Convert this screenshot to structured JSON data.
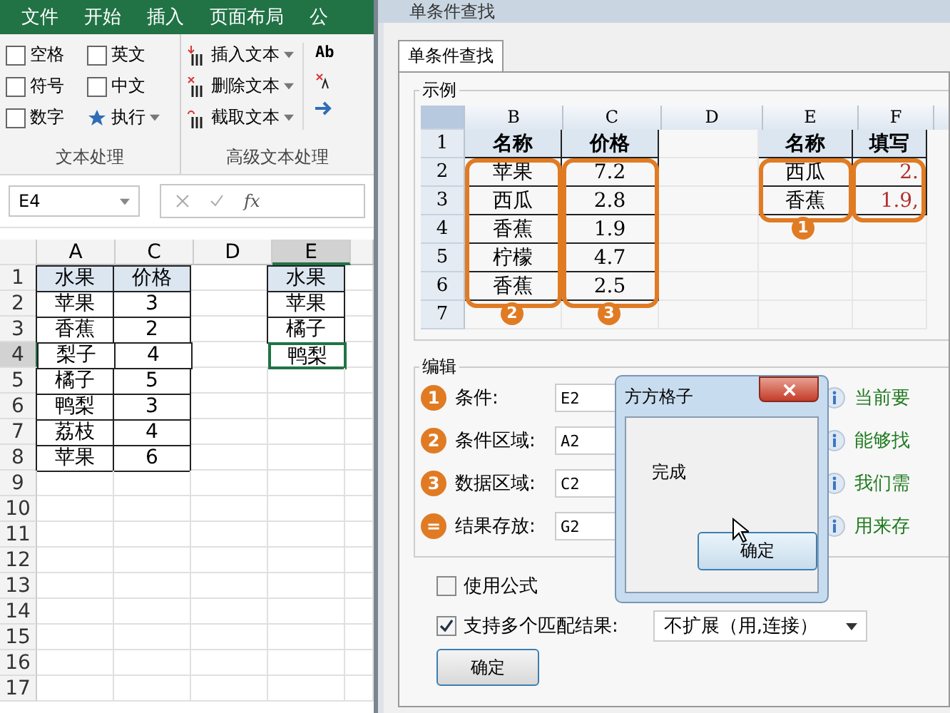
{
  "excel": {
    "menu": [
      "文件",
      "开始",
      "插入",
      "页面布局",
      "公"
    ],
    "checks": [
      {
        "label": "空格",
        "checked": false
      },
      {
        "label": "英文",
        "checked": false
      },
      {
        "label": "符号",
        "checked": false
      },
      {
        "label": "中文",
        "checked": false
      },
      {
        "label": "数字",
        "checked": false
      }
    ],
    "run_button": "执行",
    "group1": "文本处理",
    "tools": [
      {
        "label": "插入文本",
        "kind": "insert"
      },
      {
        "label": "删除文本",
        "kind": "delete"
      },
      {
        "label": "截取文本",
        "kind": "cut"
      }
    ],
    "partial_tool": "Ab",
    "group2": "高级文本处理",
    "name_box": "E4",
    "fx": "fx",
    "columns": [
      {
        "label": "A",
        "selected": false
      },
      {
        "label": "C",
        "selected": false
      },
      {
        "label": "D",
        "selected": false
      },
      {
        "label": "E",
        "selected": true
      }
    ],
    "rows": [
      {
        "num": "1",
        "kind": "header",
        "selected": false,
        "a": "水果",
        "c": "价格",
        "e": "水果"
      },
      {
        "num": "2",
        "kind": "data",
        "selected": false,
        "a": "苹果",
        "c": "3",
        "e": "苹果"
      },
      {
        "num": "3",
        "kind": "data",
        "selected": false,
        "a": "香蕉",
        "c": "2",
        "e": "橘子"
      },
      {
        "num": "4",
        "kind": "data",
        "selected": true,
        "a": "梨子",
        "c": "4",
        "e": "鸭梨"
      },
      {
        "num": "5",
        "kind": "data",
        "selected": false,
        "a": "橘子",
        "c": "5"
      },
      {
        "num": "6",
        "kind": "data",
        "selected": false,
        "a": "鸭梨",
        "c": "3"
      },
      {
        "num": "7",
        "kind": "data",
        "selected": false,
        "a": "荔枝",
        "c": "4"
      },
      {
        "num": "8",
        "kind": "data",
        "selected": false,
        "a": "苹果",
        "c": "6"
      },
      {
        "num": "9",
        "kind": "blank",
        "selected": false
      },
      {
        "num": "10",
        "kind": "blank",
        "selected": false
      },
      {
        "num": "11",
        "kind": "blank",
        "selected": false
      },
      {
        "num": "12",
        "kind": "blank",
        "selected": false
      },
      {
        "num": "13",
        "kind": "blank",
        "selected": false
      },
      {
        "num": "14",
        "kind": "blank",
        "selected": false
      },
      {
        "num": "15",
        "kind": "blank",
        "selected": false
      },
      {
        "num": "16",
        "kind": "blank",
        "selected": false
      },
      {
        "num": "17",
        "kind": "blank",
        "selected": false
      }
    ]
  },
  "dialog": {
    "title": "单条件查找",
    "tab": "单条件查找",
    "sample_title": "示例",
    "sample_columns": [
      "B",
      "C",
      "D",
      "E",
      "F"
    ],
    "sample_rows": [
      {
        "num": "1",
        "kind": "header",
        "b": "名称",
        "c": "价格",
        "e": "名称",
        "f": "填写"
      },
      {
        "num": "2",
        "kind": "data",
        "b": "苹果",
        "c": "7.2",
        "e": "西瓜",
        "f": "2."
      },
      {
        "num": "3",
        "kind": "data",
        "b": "西瓜",
        "c": "2.8",
        "e": "香蕉",
        "f": "1.9,"
      },
      {
        "num": "4",
        "kind": "data",
        "b": "香蕉",
        "c": "1.9"
      },
      {
        "num": "5",
        "kind": "data",
        "b": "柠檬",
        "c": "4.7"
      },
      {
        "num": "6",
        "kind": "data",
        "b": "香蕉",
        "c": "2.5"
      },
      {
        "num": "7",
        "kind": "blank"
      }
    ],
    "markers": [
      "2",
      "3",
      "1"
    ],
    "edit_title": "编辑",
    "fields": [
      {
        "badge": "1",
        "label": "条件:",
        "value": "E2",
        "hint": "当前要"
      },
      {
        "badge": "2",
        "label": "条件区域:",
        "value": "A2",
        "hint": "能够找"
      },
      {
        "badge": "3",
        "label": "数据区域:",
        "value": "C2",
        "hint": "我们需"
      },
      {
        "badge": "=",
        "label": "结果存放:",
        "value": "G2",
        "hint": "用来存"
      }
    ],
    "options": [
      {
        "label": "使用公式",
        "checked": false
      },
      {
        "label": "支持多个匹配结果:",
        "checked": true
      }
    ],
    "dropdown": "不扩展（用,连接）",
    "ok": "确定"
  },
  "message_box": {
    "title": "方方格子",
    "text": "完成",
    "button": "确定"
  }
}
